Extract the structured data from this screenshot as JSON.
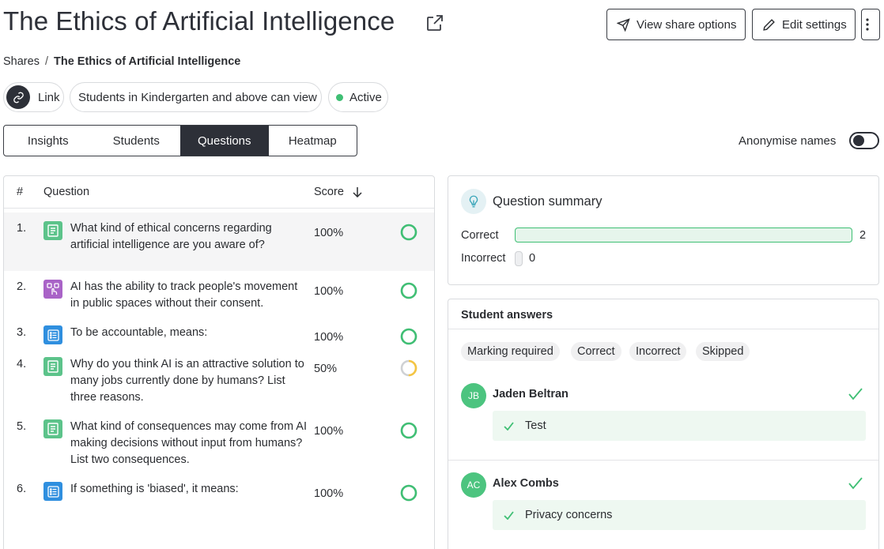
{
  "header": {
    "title": "The Ethics of Artificial Intelligence",
    "share_button": "View share options",
    "edit_button": "Edit settings"
  },
  "breadcrumb": {
    "root": "Shares",
    "separator": "/",
    "current": "The Ethics of Artificial Intelligence"
  },
  "chips": {
    "link": "Link",
    "students": "Students in Kindergarten and above can view",
    "status": "Active"
  },
  "tabs": [
    "Insights",
    "Students",
    "Questions",
    "Heatmap"
  ],
  "active_tab": "Questions",
  "anonymise": {
    "label": "Anonymise names",
    "enabled": false
  },
  "questions": {
    "headers": {
      "number": "#",
      "question": "Question",
      "score": "Score"
    },
    "rows": [
      {
        "num": "1.",
        "type": "text-response-icon",
        "text": "What kind of ethical concerns regarding artificial intelligence are you aware of?",
        "score": "100%",
        "fraction": 1.0
      },
      {
        "num": "2.",
        "type": "drag-drop-icon",
        "text": "AI has the ability to track people's movement in public spaces without their consent.",
        "score": "100%",
        "fraction": 1.0
      },
      {
        "num": "3.",
        "type": "multiple-choice-icon",
        "text": "To be accountable, means:",
        "score": "100%",
        "fraction": 1.0
      },
      {
        "num": "4.",
        "type": "text-response-icon",
        "text": "Why do you think AI is an attractive solution to many jobs currently done by humans? List three reasons.",
        "score": "50%",
        "fraction": 0.5
      },
      {
        "num": "5.",
        "type": "text-response-icon",
        "text": "What kind of consequences may come from AI making decisions without input from humans? List two consequences.",
        "score": "100%",
        "fraction": 1.0
      },
      {
        "num": "6.",
        "type": "multiple-choice-icon",
        "text": "If something is 'biased', it means:",
        "score": "100%",
        "fraction": 1.0
      }
    ]
  },
  "summary": {
    "title": "Question summary",
    "correct_label": "Correct",
    "correct_count": "2",
    "incorrect_label": "Incorrect",
    "incorrect_count": "0"
  },
  "answers": {
    "title": "Student answers",
    "filters": [
      "Marking required",
      "Correct",
      "Incorrect",
      "Skipped"
    ],
    "students": [
      {
        "initials": "JB",
        "name": "Jaden Beltran",
        "answer": "Test"
      },
      {
        "initials": "AC",
        "name": "Alex Combs",
        "answer": "Privacy concerns"
      }
    ]
  },
  "colors": {
    "accent_dark": "#2d3038",
    "success": "#3fbf74",
    "warning": "#f5c542",
    "text_icon": "#5cc38a",
    "multi_choice_icon": "#2f8fdf",
    "drag_drop_icon": "#a963c7"
  }
}
